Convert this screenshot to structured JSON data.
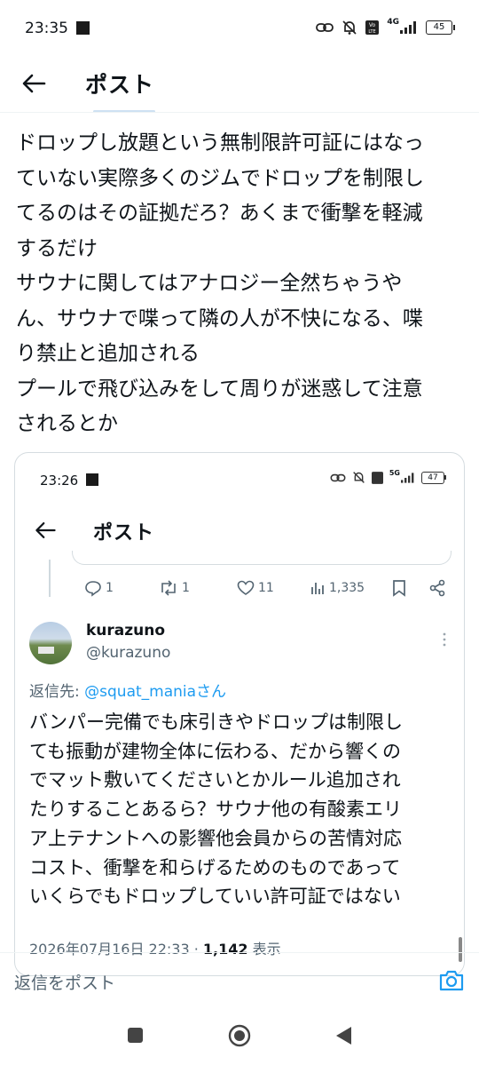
{
  "status_bar": {
    "time": "23:35",
    "network": "4G",
    "battery": "45"
  },
  "header": {
    "title": "ポスト"
  },
  "post": {
    "text": "ドロップし放題という無制限許可証にはなっ\nていない実際多くのジムでドロップを制限し\nてるのはその証拠だろ？あくまで衝撃を軽減\nするだけ\nサウナに関してはアナロジー全然ちゃうや\nん、サウナで喋って隣の人が不快になる、喋\nり禁止と追加される\nプールで飛び込みをして周りが迷惑して注意\nされるとか"
  },
  "embedded": {
    "status_bar": {
      "time": "23:26",
      "network": "5G",
      "battery": "47"
    },
    "header": {
      "title": "ポスト"
    },
    "actions": {
      "replies": "1",
      "reposts": "1",
      "likes": "11",
      "views": "1,335"
    },
    "user": {
      "name": "kurazuno",
      "handle": "@kurazuno"
    },
    "reply_to": {
      "prefix": "返信先: ",
      "mention": "@squat_mania",
      "suffix": "さん"
    },
    "text": "バンパー完備でも床引きやドロップは制限し\nても振動が建物全体に伝わる、だから響くの\nでマット敷いてくださいとかルール追加され\nたりすることあるら？サウナ他の有酸素エリ\nア上テナントへの影響他会員からの苦情対応\nコスト、衝撃を和らげるためのものであって\nいくらでもドロップしていい許可証ではない",
    "meta": {
      "date": "2026年07月16日 22:33 · ",
      "views_count": "1,142",
      "views_label": " 表示"
    }
  },
  "reply_bar": {
    "placeholder": "返信をポスト"
  },
  "colors": {
    "accent": "#1d9bf0",
    "text": "#0f1419",
    "muted": "#536471"
  },
  "icons": [
    "back-arrow-icon",
    "camera-icon",
    "reply-icon",
    "repost-icon",
    "like-icon",
    "views-icon",
    "bookmark-icon",
    "share-icon",
    "more-icon"
  ]
}
